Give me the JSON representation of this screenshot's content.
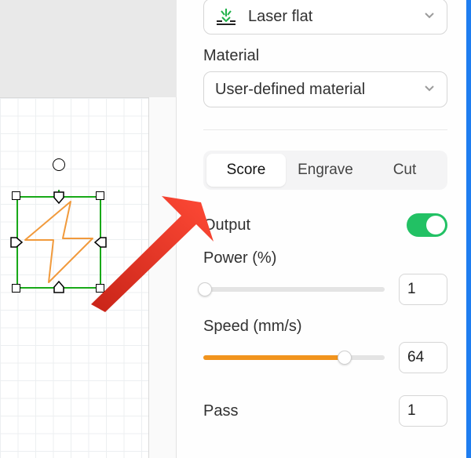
{
  "toolbar": {
    "mode_label": "Laser flat"
  },
  "material": {
    "label": "Material",
    "selected": "User-defined material"
  },
  "tabs": {
    "score": "Score",
    "engrave": "Engrave",
    "cut": "Cut",
    "active": "score"
  },
  "output": {
    "label": "Output",
    "enabled": true
  },
  "power": {
    "label": "Power (%)",
    "value": "1",
    "percent": 1
  },
  "speed": {
    "label": "Speed (mm/s)",
    "value": "64",
    "percent": 78
  },
  "pass": {
    "label": "Pass",
    "value": "1"
  },
  "annotation": {
    "arrow_color": "#f13b2d"
  }
}
